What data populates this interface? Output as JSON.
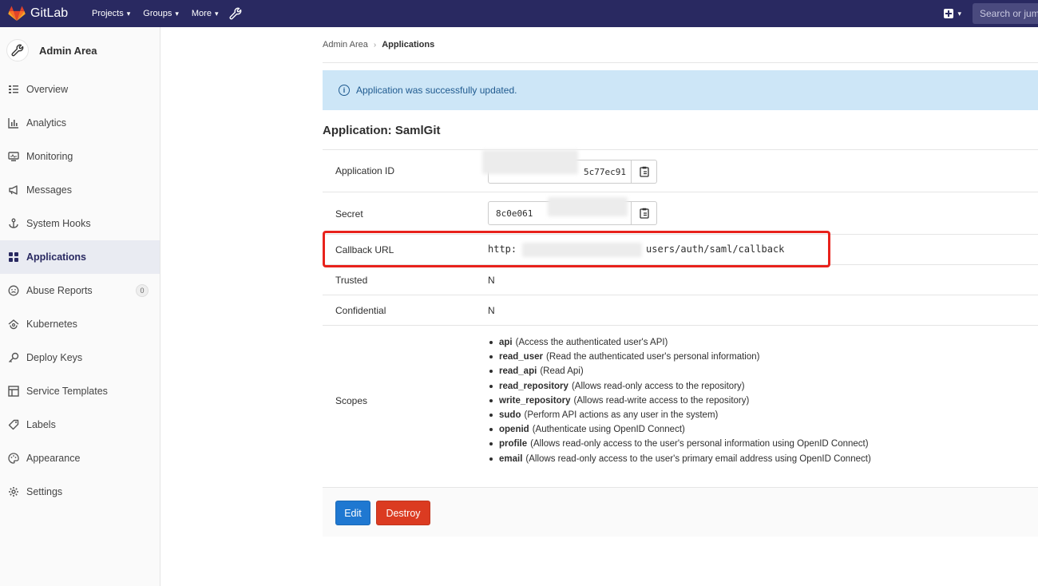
{
  "navbar": {
    "brand": "GitLab",
    "links": [
      {
        "label": "Projects"
      },
      {
        "label": "Groups"
      },
      {
        "label": "More"
      }
    ],
    "search_placeholder": "Search or jump to…"
  },
  "sidebar": {
    "title": "Admin Area",
    "items": [
      {
        "label": "Overview",
        "icon": "overview-icon"
      },
      {
        "label": "Analytics",
        "icon": "analytics-icon"
      },
      {
        "label": "Monitoring",
        "icon": "monitoring-icon"
      },
      {
        "label": "Messages",
        "icon": "messages-icon"
      },
      {
        "label": "System Hooks",
        "icon": "hook-icon"
      },
      {
        "label": "Applications",
        "icon": "applications-icon",
        "active": true
      },
      {
        "label": "Abuse Reports",
        "icon": "abuse-icon",
        "badge": "0"
      },
      {
        "label": "Kubernetes",
        "icon": "kubernetes-icon"
      },
      {
        "label": "Deploy Keys",
        "icon": "key-icon"
      },
      {
        "label": "Service Templates",
        "icon": "template-icon"
      },
      {
        "label": "Labels",
        "icon": "label-icon"
      },
      {
        "label": "Appearance",
        "icon": "appearance-icon"
      },
      {
        "label": "Settings",
        "icon": "gear-icon"
      }
    ]
  },
  "breadcrumb": {
    "parent": "Admin Area",
    "current": "Applications"
  },
  "alert": {
    "message": "Application was successfully updated."
  },
  "application": {
    "title": "Application: SamlGit",
    "rows": {
      "id_label": "Application ID",
      "id_value": "5c77ec91",
      "secret_label": "Secret",
      "secret_value": "8c0e061",
      "callback_label": "Callback URL",
      "callback_prefix": "http:",
      "callback_suffix": "users/auth/saml/callback",
      "trusted_label": "Trusted",
      "trusted_value": "N",
      "confidential_label": "Confidential",
      "confidential_value": "N",
      "scopes_label": "Scopes"
    },
    "scopes": [
      {
        "name": "api",
        "desc": "(Access the authenticated user's API)"
      },
      {
        "name": "read_user",
        "desc": "(Read the authenticated user's personal information)"
      },
      {
        "name": "read_api",
        "desc": "(Read Api)"
      },
      {
        "name": "read_repository",
        "desc": "(Allows read-only access to the repository)"
      },
      {
        "name": "write_repository",
        "desc": "(Allows read-write access to the repository)"
      },
      {
        "name": "sudo",
        "desc": "(Perform API actions as any user in the system)"
      },
      {
        "name": "openid",
        "desc": "(Authenticate using OpenID Connect)"
      },
      {
        "name": "profile",
        "desc": "(Allows read-only access to the user's personal information using OpenID Connect)"
      },
      {
        "name": "email",
        "desc": "(Allows read-only access to the user's primary email address using OpenID Connect)"
      }
    ]
  },
  "actions": {
    "edit_label": "Edit",
    "destroy_label": "Destroy"
  },
  "colors": {
    "navbar": "#292961",
    "primary": "#1f78d1",
    "danger": "#db3b21",
    "highlight": "#e8221c"
  }
}
